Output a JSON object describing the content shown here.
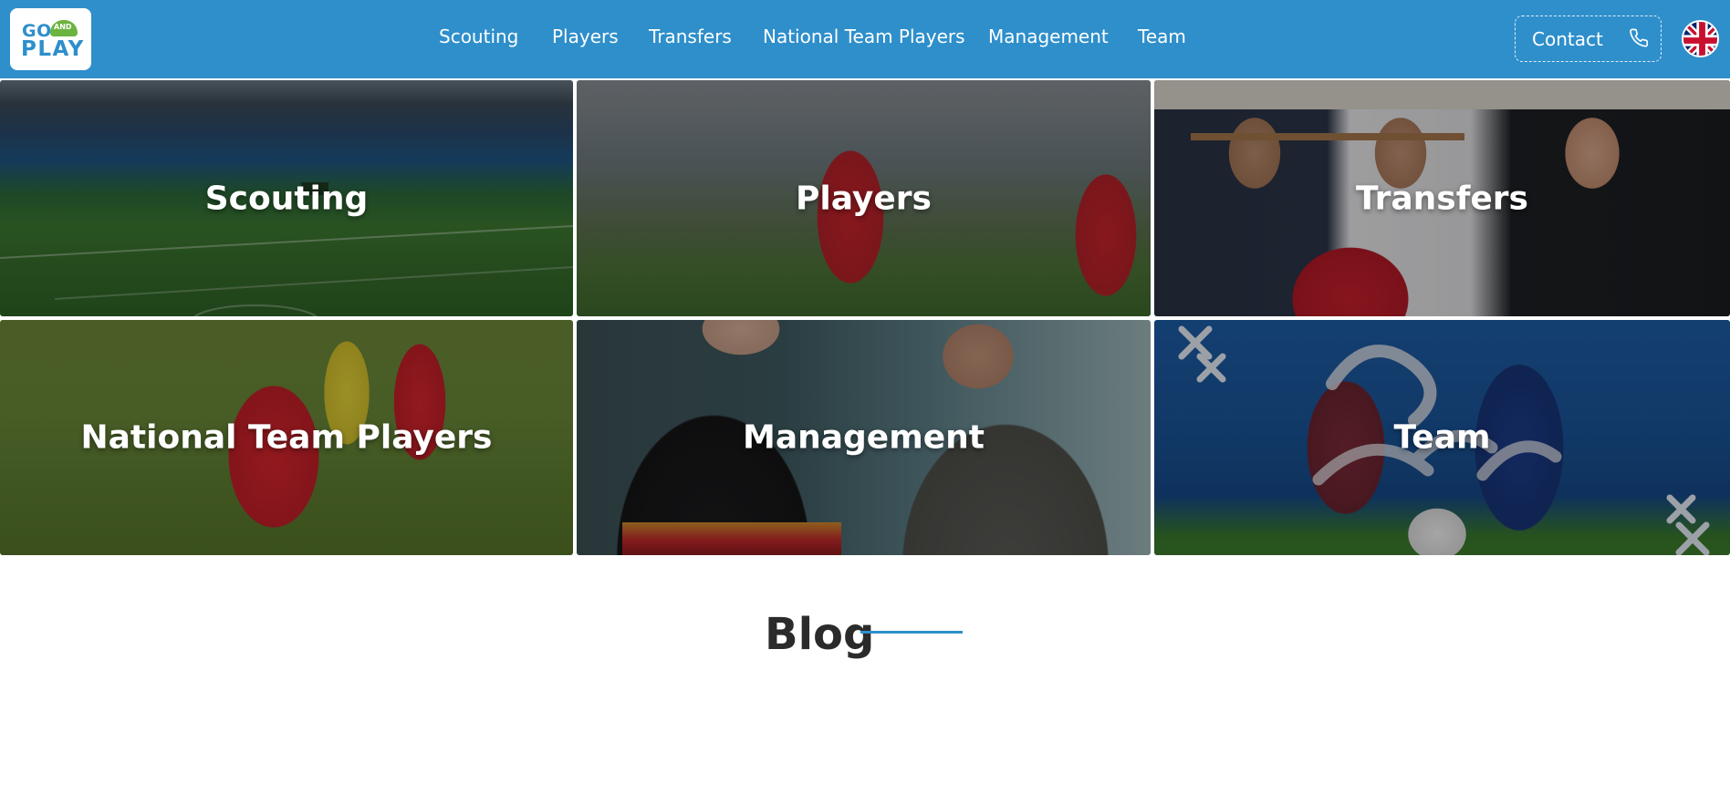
{
  "logo": {
    "line1": "GO",
    "badge": "AND",
    "line2": "PLAY"
  },
  "nav": {
    "items": [
      {
        "label": "Scouting"
      },
      {
        "label": "Players"
      },
      {
        "label": "Transfers"
      },
      {
        "label": "National Team Players"
      },
      {
        "label": "Management"
      },
      {
        "label": "Team"
      }
    ],
    "contact_label": "Contact",
    "contact_icon": "phone-icon",
    "language_icon": "uk-flag-icon"
  },
  "tiles": [
    {
      "label": "Scouting"
    },
    {
      "label": "Players"
    },
    {
      "label": "Transfers"
    },
    {
      "label": "National Team Players"
    },
    {
      "label": "Management"
    },
    {
      "label": "Team"
    }
  ],
  "blog": {
    "title": "Blog"
  },
  "colors": {
    "brand_blue": "#2e8fcb",
    "logo_green": "#6cb33f",
    "background": "#ffffff"
  }
}
